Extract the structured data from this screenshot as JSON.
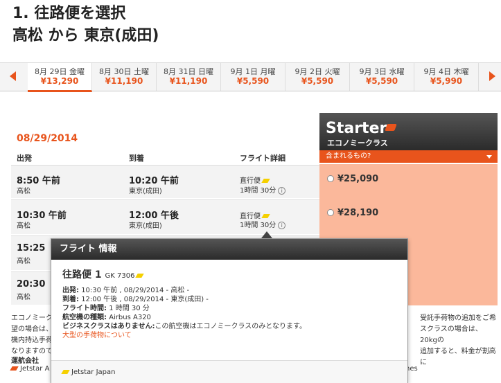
{
  "heading": {
    "line1": "1. 往路便を選択",
    "line2": "高松 から 東京(成田)"
  },
  "dates": [
    {
      "label": "8月 29日 金曜",
      "price": "¥13,290",
      "selected": true
    },
    {
      "label": "8月 30日 土曜",
      "price": "¥11,190"
    },
    {
      "label": "8月 31日 日曜",
      "price": "¥11,190"
    },
    {
      "label": "9月 1日 月曜",
      "price": "¥5,590"
    },
    {
      "label": "9月 2日 火曜",
      "price": "¥5,590"
    },
    {
      "label": "9月 3日 水曜",
      "price": "¥5,590"
    },
    {
      "label": "9月 4日 木曜",
      "price": "¥5,990"
    }
  ],
  "route_date": "08/29/2014",
  "columns": {
    "depart": "出発",
    "arrive": "到着",
    "details": "フライト詳細"
  },
  "fare_class": {
    "brand": "Starter",
    "sub": "エコノミークラス",
    "includes": "含まれるもの?"
  },
  "flights": [
    {
      "dep_time": "8:50 午前",
      "dep_place": "高松",
      "arr_time": "10:20 午前",
      "arr_place": "東京(成田)",
      "type": "直行便",
      "duration": "1時間 30分",
      "fare": "¥25,090"
    },
    {
      "dep_time": "10:30 午前",
      "dep_place": "高松",
      "arr_time": "12:00 午後",
      "arr_place": "東京(成田)",
      "type": "直行便",
      "duration": "1時間 30分",
      "fare": "¥28,190"
    },
    {
      "dep_time": "15:25",
      "dep_place": "高松"
    },
    {
      "dep_time": "20:30",
      "dep_place": "高松"
    }
  ],
  "footer": {
    "left": "エコノミークラ",
    "left2": "望の場合は、",
    "left3": "機内持込手荷",
    "left4": "なりますので",
    "right": "受託手荷物の追加をご希",
    "right2": "スクラスの場合は、20kgの",
    "right3": "追加すると、料金が割高に",
    "operator_label": "運航会社",
    "operator": "Jetstar A",
    "operator_tail": "nes"
  },
  "popup": {
    "title": "フライト 情報",
    "segment": "往路便 1",
    "flight_no": "GK 7306",
    "depart_label": "出発:",
    "depart": "10:30 午前 , 08/29/2014 - 高松 -",
    "arrive_label": "到着:",
    "arrive": "12:00 午後 , 08/29/2014 - 東京(成田) -",
    "duration_label": "フライト時間:",
    "duration": "1 時間 30 分",
    "aircraft_label": "航空機の種類:",
    "aircraft": "Airbus A320",
    "business_label": "ビジネスクラスはありません:",
    "business": "この航空機はエコノミークラスのみとなります。",
    "baggage_link": "大型の手荷物について",
    "operator": "Jetstar Japan"
  },
  "colors": {
    "accent": "#e8541c",
    "fare_bg": "#fbb89b",
    "header_dark": "#2b2b2b"
  }
}
